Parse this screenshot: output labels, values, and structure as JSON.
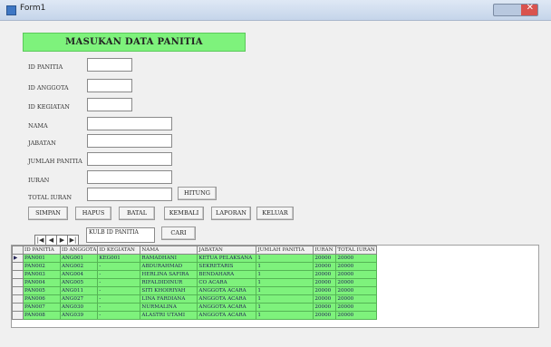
{
  "window": {
    "title": "Form1"
  },
  "form": {
    "heading": "MASUKAN DATA PANITIA",
    "labels": {
      "id_panitia": "ID PANITIA",
      "id_anggota": "ID ANGGOTA",
      "id_kegiatan": "ID KEGIATAN",
      "nama": "NAMA",
      "jabatan": "JABATAN",
      "jumlah_panitia": "JUMLAH PANITIA",
      "iuran": "IURAN",
      "total_iuran": "TOTAL IURAN"
    },
    "buttons": {
      "hitung": "HITUNG",
      "simpan": "SIMPAN",
      "hapus": "HAPUS",
      "batal": "BATAL",
      "kembali": "KEMBALI",
      "laporan": "LAPORAN",
      "keluar": "KELUAR",
      "cari": "CARI"
    },
    "search_value": "KULB ID PANITIA",
    "nav": {
      "first": "|◀",
      "prev": "◀",
      "next": "▶",
      "last": "▶|"
    }
  },
  "grid": {
    "columns": [
      "ID PANITIA",
      "ID ANGGOTA",
      "ID KEGIATAN",
      "NAMA",
      "JABATAN",
      "JUMLAH PANITIA",
      "IURAN",
      "TOTAL IURAN"
    ],
    "rows": [
      [
        "PAN001",
        "ANG001",
        "KEG001",
        "RAMADHANI",
        "KETUA PELAKSANA",
        "1",
        "20000",
        "20000"
      ],
      [
        "PAN002",
        "ANG002",
        "-",
        "ABDURAHMAD",
        "SEKRETARIS",
        "1",
        "20000",
        "20000"
      ],
      [
        "PAN003",
        "ANG004",
        "-",
        "HERLINA SAFIRA",
        "BENDAHARA",
        "1",
        "20000",
        "20000"
      ],
      [
        "PAN004",
        "ANG005",
        "-",
        "RIFALDIDINUR",
        "CO ACARA",
        "1",
        "20000",
        "20000"
      ],
      [
        "PAN005",
        "ANG011",
        "-",
        "SITI KHOIRIYAH",
        "ANGGOTA ACARA",
        "1",
        "20000",
        "20000"
      ],
      [
        "PAN006",
        "ANG027",
        "-",
        "LINA FARDIANA",
        "ANGGOTA ACARA",
        "1",
        "20000",
        "20000"
      ],
      [
        "PAN007",
        "ANG030",
        "-",
        "NURMALINA",
        "ANGGOTA ACARA",
        "1",
        "20000",
        "20000"
      ],
      [
        "PAN008",
        "ANG039",
        "-",
        "ALASTRI UTAMI",
        "ANGGOTA ACARA",
        "1",
        "20000",
        "20000"
      ]
    ],
    "current_row_marker": "▶"
  },
  "colors": {
    "accent_green": "#7ef27c",
    "window_bg": "#f0f0f0"
  }
}
